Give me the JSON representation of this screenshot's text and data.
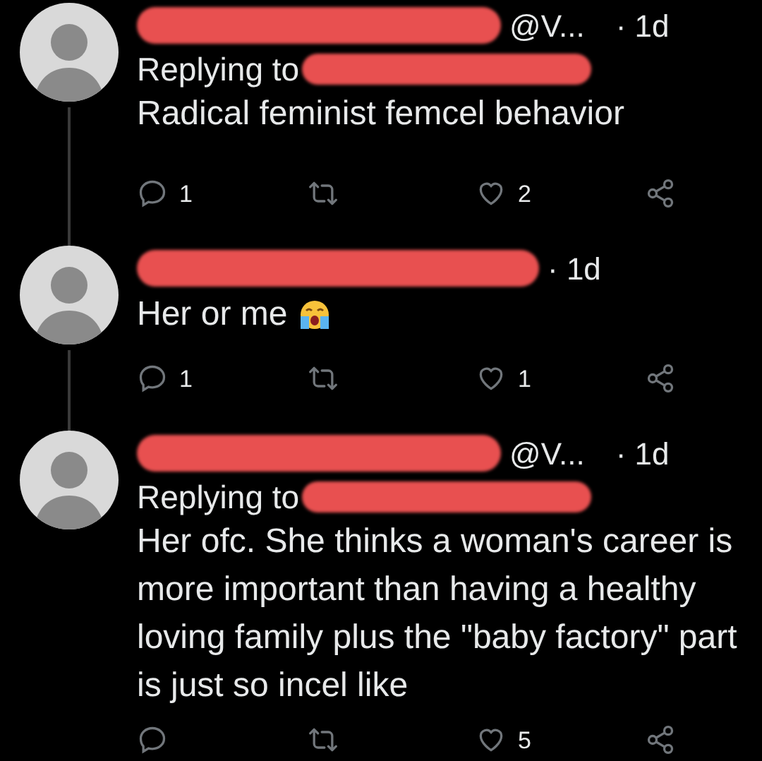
{
  "tweets": [
    {
      "handle": "@V...",
      "time": "· 1d",
      "replying_label": "Replying to",
      "body": "Radical feminist femcel behavior",
      "emoji": false,
      "reply_count": "1",
      "like_count": "2"
    },
    {
      "time": "· 1d",
      "body": "Her or me",
      "emoji": true,
      "reply_count": "1",
      "like_count": "1"
    },
    {
      "handle": "@V...",
      "time": "· 1d",
      "replying_label": "Replying to",
      "body": "Her ofc. She thinks a woman's career is more important than having a healthy loving family plus the \"baby factory\" part is just so incel like",
      "emoji": false,
      "like_count": "5"
    }
  ]
}
